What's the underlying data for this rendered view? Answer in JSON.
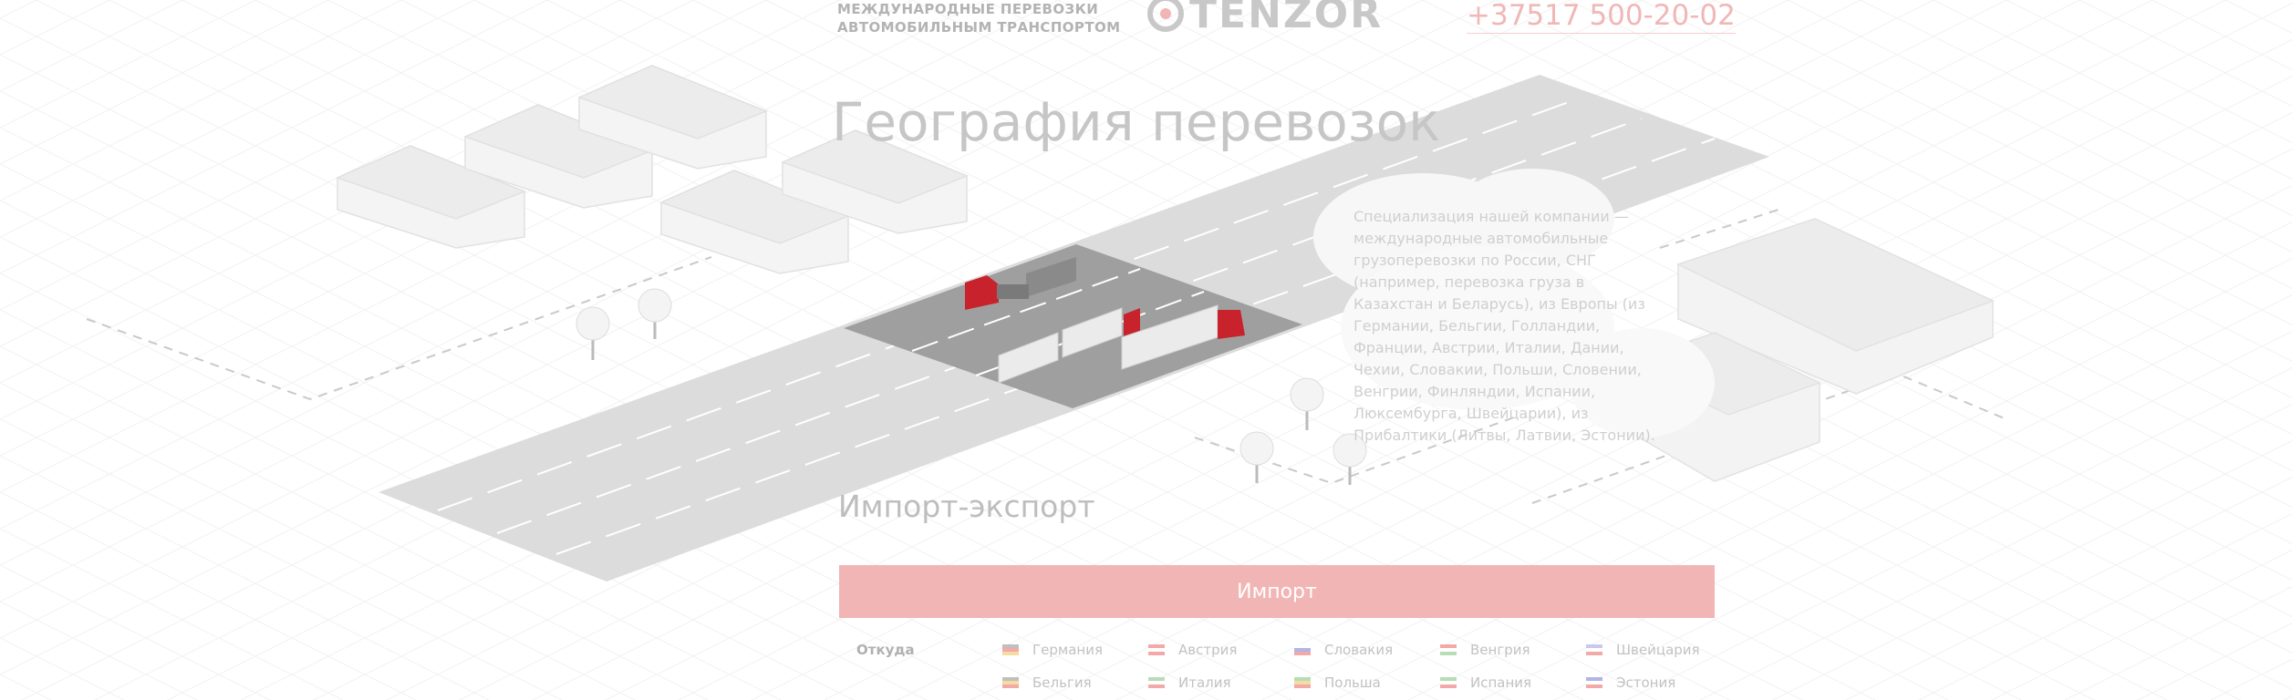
{
  "header": {
    "tagline_line1": "МЕЖДУНАРОДНЫЕ ПЕРЕВОЗКИ",
    "tagline_line2": "АВТОМОБИЛЬНЫМ ТРАНСПОРТОМ",
    "logo_text": "TENZOR",
    "phone": "+37517 500-20-02"
  },
  "main": {
    "title": "География перевозок",
    "description": "Специализация нашей компании — международные автомобильные грузоперевозки по России, СНГ (например, перевозка груза в Казахстан и Беларусь), из Европы (из Германии, Бельгии, Голландии, Франции, Австрии, Италии, Дании, Чехии, Словакии, Польши, Словении, Венгрии, Финляндии, Испании, Люксембурга, Швейцарии), из Прибалтики (Литвы, Латвии, Эстонии)."
  },
  "import_export": {
    "title": "Импорт-экспорт",
    "tab_import": "Импорт",
    "from_label": "Откуда",
    "countries": [
      {
        "name": "Германия",
        "icon": "germany-flag-icon",
        "colors": [
          "#bfbfbf",
          "#f4a9a9",
          "#f5dca0"
        ]
      },
      {
        "name": "Австрия",
        "icon": "austria-flag-icon",
        "colors": [
          "#f4a9a9",
          "#ffffff",
          "#f4a9a9"
        ]
      },
      {
        "name": "Словакия",
        "icon": "slovakia-flag-icon",
        "colors": [
          "#ffffff",
          "#b3b3e6",
          "#f4a9a9"
        ]
      },
      {
        "name": "Венгрия",
        "icon": "hungary-flag-icon",
        "colors": [
          "#f4a9a9",
          "#ffffff",
          "#b7ddb7"
        ]
      },
      {
        "name": "Швейцария",
        "icon": "switzerland-flag-icon",
        "colors": [
          "#c9c9f0",
          "#ffffff",
          "#f4a9a9"
        ]
      },
      {
        "name": "Бельгия",
        "icon": "belgium-flag-icon",
        "colors": [
          "#bfbfbf",
          "#f5dca0",
          "#f4a9a9"
        ]
      },
      {
        "name": "Италия",
        "icon": "italy-flag-icon",
        "colors": [
          "#b7ddb7",
          "#ffffff",
          "#f4a9a9"
        ]
      },
      {
        "name": "Польша",
        "icon": "poland-flag-icon",
        "colors": [
          "#b7ddb7",
          "#f5dca0",
          "#f4a9a9"
        ]
      },
      {
        "name": "Испания",
        "icon": "spain-flag-icon",
        "colors": [
          "#b7ddb7",
          "#ffffff",
          "#f4a9a9"
        ]
      },
      {
        "name": "Эстония",
        "icon": "estonia-flag-icon",
        "colors": [
          "#b3b3e6",
          "#ffffff",
          "#f4a9a9"
        ]
      }
    ]
  },
  "colors": {
    "accent": "#f2b5b5",
    "truck_red": "#c8232c",
    "road": "#d9d9d9",
    "road_highlight": "#9e9e9e"
  }
}
